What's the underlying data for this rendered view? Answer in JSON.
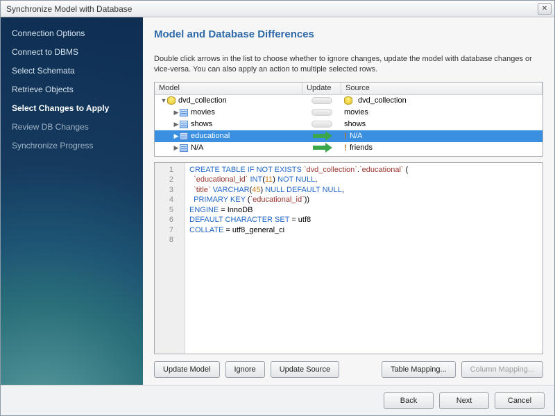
{
  "window": {
    "title": "Synchronize Model with Database"
  },
  "sidebar": {
    "steps": [
      {
        "label": "Connection Options",
        "state": "past"
      },
      {
        "label": "Connect to DBMS",
        "state": "past"
      },
      {
        "label": "Select Schemata",
        "state": "past"
      },
      {
        "label": "Retrieve Objects",
        "state": "past"
      },
      {
        "label": "Select Changes to Apply",
        "state": "active"
      },
      {
        "label": "Review DB Changes",
        "state": "future"
      },
      {
        "label": "Synchronize Progress",
        "state": "future"
      }
    ]
  },
  "main": {
    "heading": "Model and Database Differences",
    "description": "Double click arrows in the list to choose whether to ignore changes, update the model with database changes or vice-versa. You can also apply an action to multiple selected rows.",
    "columns": {
      "model": "Model",
      "update": "Update",
      "source": "Source"
    },
    "rows": [
      {
        "indent": 0,
        "expanded": true,
        "icon": "db",
        "model": "dvd_collection",
        "arrow": "neutral",
        "source_icon": "db",
        "source": "dvd_collection",
        "selected": false
      },
      {
        "indent": 1,
        "expanded": false,
        "icon": "table",
        "model": "movies",
        "arrow": "neutral",
        "source_icon": "",
        "source": "movies",
        "selected": false
      },
      {
        "indent": 1,
        "expanded": false,
        "icon": "table",
        "model": "shows",
        "arrow": "neutral",
        "source_icon": "",
        "source": "shows",
        "selected": false
      },
      {
        "indent": 1,
        "expanded": false,
        "icon": "table",
        "model": "educational",
        "arrow": "green",
        "source_icon": "warn",
        "source": "N/A",
        "selected": true
      },
      {
        "indent": 1,
        "expanded": false,
        "icon": "table",
        "model": "N/A",
        "arrow": "green",
        "source_icon": "warn",
        "source": "friends",
        "selected": false
      }
    ],
    "buttons": {
      "update_model": "Update Model",
      "ignore": "Ignore",
      "update_source": "Update Source",
      "table_mapping": "Table Mapping...",
      "column_mapping": "Column Mapping..."
    }
  },
  "sql": {
    "lines": [
      {
        "n": 1,
        "html": "<span class='kw'>CREATE TABLE IF NOT EXISTS</span> <span class='id'>`dvd_collection`</span>.<span class='id'>`educational`</span> ("
      },
      {
        "n": 2,
        "html": "  <span class='id'>`educational_id`</span> <span class='kw'>INT</span>(<span class='num'>11</span>) <span class='kw'>NOT NULL</span>,"
      },
      {
        "n": 3,
        "html": "  <span class='id'>`title`</span> <span class='kw'>VARCHAR</span>(<span class='num'>45</span>) <span class='kw'>NULL DEFAULT NULL</span>,"
      },
      {
        "n": 4,
        "html": "  <span class='kw'>PRIMARY KEY</span> (<span class='id'>`educational_id`</span>))"
      },
      {
        "n": 5,
        "html": "<span class='kw'>ENGINE</span> = InnoDB"
      },
      {
        "n": 6,
        "html": "<span class='kw'>DEFAULT CHARACTER SET</span> = utf8"
      },
      {
        "n": 7,
        "html": "<span class='kw'>COLLATE</span> = utf8_general_ci"
      },
      {
        "n": 8,
        "html": ""
      }
    ]
  },
  "footer": {
    "back": "Back",
    "next": "Next",
    "cancel": "Cancel"
  }
}
